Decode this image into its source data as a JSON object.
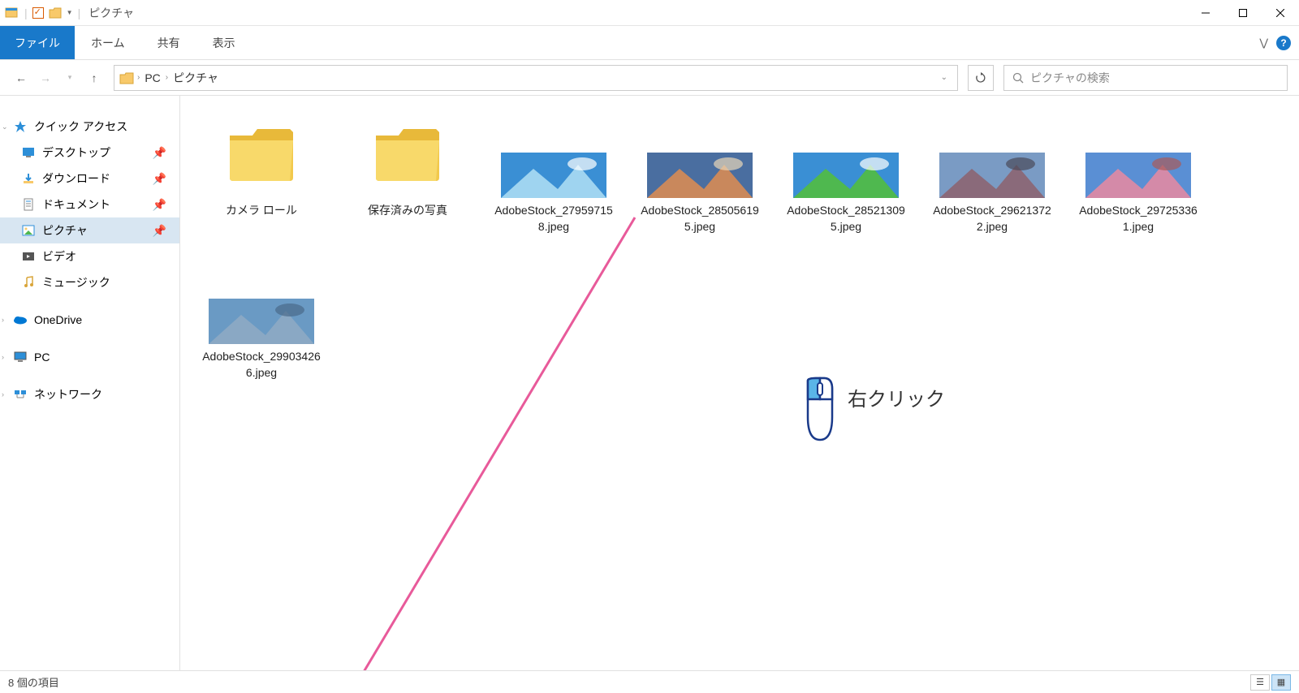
{
  "window": {
    "title": "ピクチャ"
  },
  "ribbon": {
    "file": "ファイル",
    "tabs": [
      "ホーム",
      "共有",
      "表示"
    ]
  },
  "address": {
    "crumbs": [
      "PC",
      "ピクチャ"
    ]
  },
  "search": {
    "placeholder": "ピクチャの検索"
  },
  "nav_pane": {
    "quick_access": "クイック アクセス",
    "items": [
      {
        "label": "デスクトップ",
        "pinned": true
      },
      {
        "label": "ダウンロード",
        "pinned": true
      },
      {
        "label": "ドキュメント",
        "pinned": true
      },
      {
        "label": "ピクチャ",
        "pinned": true,
        "selected": true
      },
      {
        "label": "ビデオ",
        "pinned": false
      },
      {
        "label": "ミュージック",
        "pinned": false
      }
    ],
    "onedrive": "OneDrive",
    "pc": "PC",
    "network": "ネットワーク"
  },
  "content": {
    "folders": [
      {
        "label": "カメラ ロール"
      },
      {
        "label": "保存済みの写真"
      }
    ],
    "images": [
      {
        "label": "AdobeStock_279597158.jpeg",
        "colors": [
          "#3a8fd4",
          "#9fd4f0",
          "#ffffff"
        ]
      },
      {
        "label": "AdobeStock_285056195.jpeg",
        "colors": [
          "#4a6ea0",
          "#c9885c",
          "#e8d5b8"
        ]
      },
      {
        "label": "AdobeStock_285213095.jpeg",
        "colors": [
          "#3a8fd4",
          "#4fb84f",
          "#ffffff"
        ]
      },
      {
        "label": "AdobeStock_296213722.jpeg",
        "colors": [
          "#7a9bc4",
          "#8a6a7a",
          "#4a4a5a"
        ]
      },
      {
        "label": "AdobeStock_297253361.jpeg",
        "colors": [
          "#5a8fd4",
          "#d48aa8",
          "#a85a5a"
        ]
      },
      {
        "label": "AdobeStock_299034266.jpeg",
        "colors": [
          "#6a9ac4",
          "#8aa8c4",
          "#4a6a8a"
        ]
      }
    ]
  },
  "status": {
    "text": "8 個の項目"
  },
  "annotation": {
    "text": "右クリック"
  }
}
